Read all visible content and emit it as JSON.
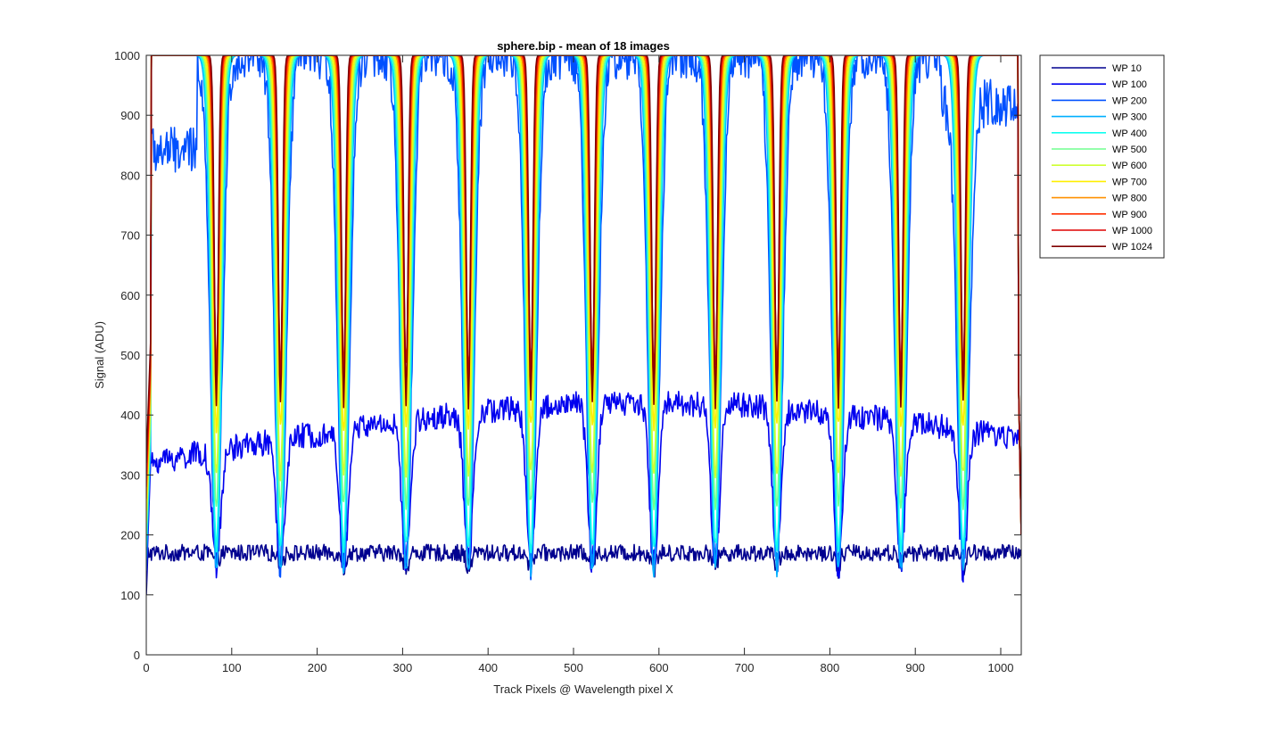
{
  "chart_data": {
    "type": "line",
    "title": "sphere.bip - mean of 18 images",
    "xlabel": "Track Pixels @ Wavelength pixel X",
    "ylabel": "Signal (ADU)",
    "xlim": [
      0,
      1024
    ],
    "ylim": [
      0,
      1000
    ],
    "xticks": [
      0,
      100,
      200,
      300,
      400,
      500,
      600,
      700,
      800,
      900,
      1000
    ],
    "yticks": [
      0,
      100,
      200,
      300,
      400,
      500,
      600,
      700,
      800,
      900,
      1000
    ],
    "grid": false,
    "legend_position": "outside-top-right",
    "dip_centers": [
      82,
      157,
      231,
      304,
      377,
      450,
      522,
      594,
      666,
      738,
      810,
      883,
      956
    ],
    "series": [
      {
        "name": "WP 10",
        "color": "#00008f",
        "baseline": 170,
        "noise": 14,
        "dip_min": 150,
        "dip_width": 3
      },
      {
        "name": "WP 100",
        "color": "#0000ef",
        "baseline": 370,
        "noise": 22,
        "dip_min": 150,
        "dip_width": 5
      },
      {
        "name": "WP 200",
        "color": "#0050ff",
        "baseline": 1000,
        "noise": 40,
        "dip_min": 150,
        "dip_width": 7
      },
      {
        "name": "WP 300",
        "color": "#00afff",
        "baseline": 1000,
        "noise": 0,
        "dip_min": 140,
        "dip_width": 6
      },
      {
        "name": "WP 400",
        "color": "#10ffef",
        "baseline": 1000,
        "noise": 0,
        "dip_min": 180,
        "dip_width": 5.5
      },
      {
        "name": "WP 500",
        "color": "#70ff8f",
        "baseline": 1000,
        "noise": 0,
        "dip_min": 250,
        "dip_width": 5
      },
      {
        "name": "WP 600",
        "color": "#cfff30",
        "baseline": 1000,
        "noise": 0,
        "dip_min": 300,
        "dip_width": 4.5
      },
      {
        "name": "WP 700",
        "color": "#ffef00",
        "baseline": 1000,
        "noise": 0,
        "dip_min": 380,
        "dip_width": 4
      },
      {
        "name": "WP 800",
        "color": "#ff9000",
        "baseline": 1000,
        "noise": 0,
        "dip_min": 450,
        "dip_width": 3.5
      },
      {
        "name": "WP 900",
        "color": "#ff3000",
        "baseline": 1000,
        "noise": 0,
        "dip_min": 480,
        "dip_width": 3
      },
      {
        "name": "WP 1000",
        "color": "#df0000",
        "baseline": 1000,
        "noise": 0,
        "dip_min": 450,
        "dip_width": 2.6
      },
      {
        "name": "WP 1024",
        "color": "#800000",
        "baseline": 1000,
        "noise": 0,
        "dip_min": 420,
        "dip_width": 2.3
      }
    ]
  }
}
